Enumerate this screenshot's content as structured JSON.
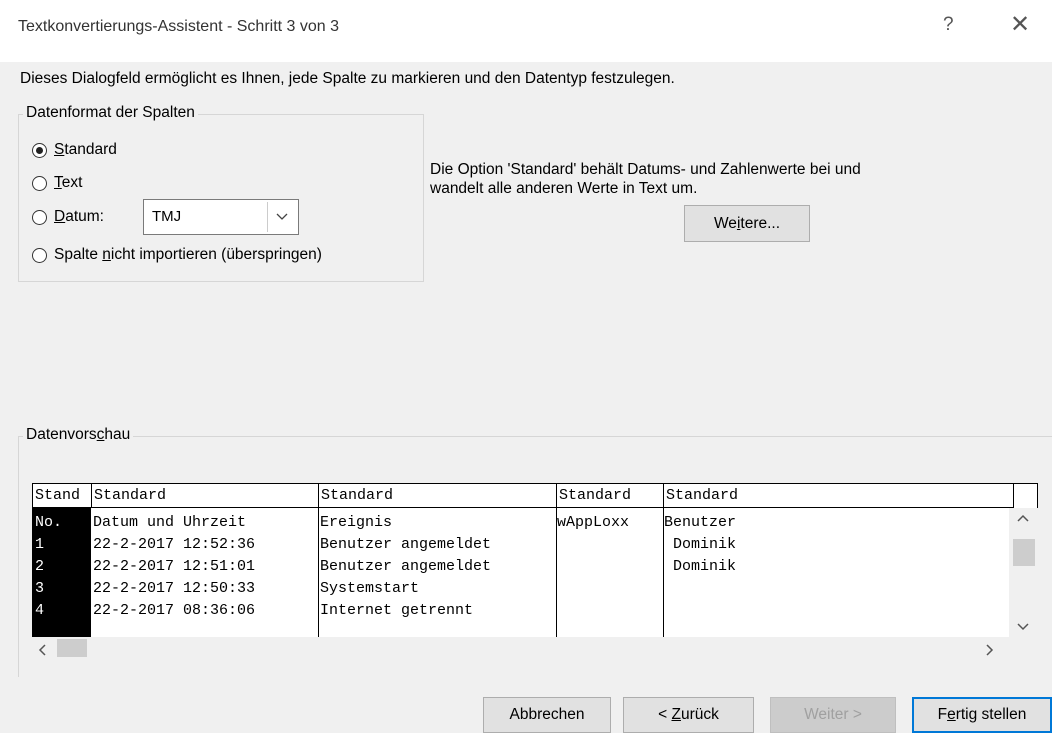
{
  "window": {
    "title": "Textkonvertierungs-Assistent - Schritt 3 von 3",
    "help_glyph": "?",
    "close_glyph": "✕"
  },
  "intro": "Dieses Dialogfeld ermöglicht es Ihnen, jede Spalte zu markieren und den Datentyp festzulegen.",
  "format_group": {
    "legend": "Datenformat der Spalten",
    "options": [
      {
        "mn": "S",
        "rest": "tandard",
        "selected": true
      },
      {
        "mn": "T",
        "rest": "ext",
        "selected": false
      },
      {
        "mn": "D",
        "rest": "atum:",
        "selected": false
      },
      {
        "pre": "Spalte ",
        "mn": "n",
        "rest": "icht importieren (überspringen)",
        "selected": false
      }
    ],
    "date_format": "TMJ"
  },
  "info_text": {
    "line1": "Die Option 'Standard' behält Datums- und Zahlenwerte bei und",
    "line2": "wandelt alle anderen Werte in Text um."
  },
  "more_button": {
    "pre": "We",
    "mn": "i",
    "rest": "tere..."
  },
  "preview": {
    "legend_pre": "Datenvors",
    "legend_mn": "c",
    "legend_rest": "hau",
    "column_headers": [
      "Stand",
      "Standard",
      "Standard",
      "Standard",
      "Standard"
    ],
    "rows": [
      [
        "No.",
        "Datum und Uhrzeit",
        "Ereignis",
        "wAppLoxx",
        "Benutzer"
      ],
      [
        "1",
        "22-2-2017 12:52:36",
        "Benutzer angemeldet",
        "",
        " Dominik"
      ],
      [
        "2",
        "22-2-2017 12:51:01",
        "Benutzer angemeldet",
        "",
        " Dominik"
      ],
      [
        "3",
        "22-2-2017 12:50:33",
        "Systemstart",
        "",
        ""
      ],
      [
        "4",
        "22-2-2017 08:36:06",
        "Internet getrennt",
        "",
        ""
      ]
    ],
    "scroll_up": "^",
    "scroll_down": "v",
    "scroll_left": "<",
    "scroll_right": ">"
  },
  "buttons": {
    "cancel": "Abbrechen",
    "back_pre": "< ",
    "back_mn": "Z",
    "back_rest": "urück",
    "next": "Weiter >",
    "finish_pre": "F",
    "finish_mn": "e",
    "finish_rest": "rtig stellen"
  }
}
